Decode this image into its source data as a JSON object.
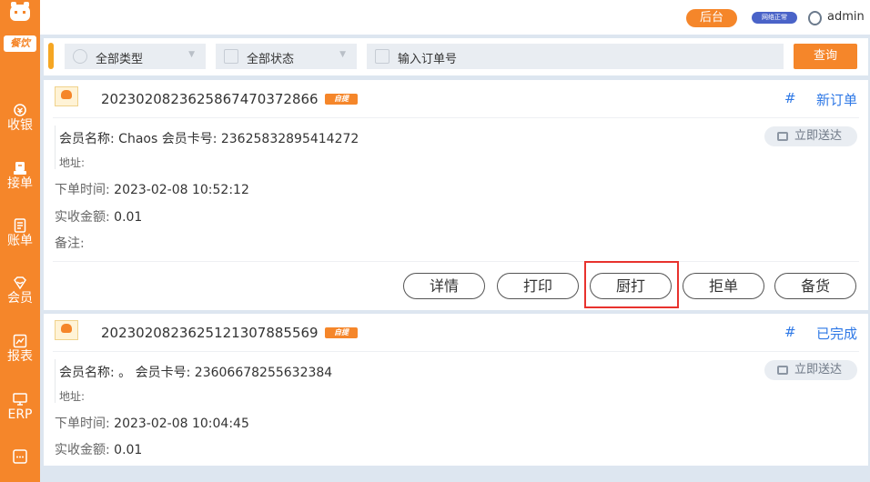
{
  "sidebar": {
    "logo_tag": "餐饮",
    "items": [
      {
        "label": "收银",
        "icon": "cashier-icon"
      },
      {
        "label": "接单",
        "icon": "receive-order-icon"
      },
      {
        "label": "账单",
        "icon": "bill-icon"
      },
      {
        "label": "会员",
        "icon": "member-icon"
      },
      {
        "label": "报表",
        "icon": "report-icon"
      },
      {
        "label": "ERP",
        "icon": "erp-icon"
      },
      {
        "label": "",
        "icon": "more-icon"
      }
    ]
  },
  "topbar": {
    "admin_button": "后台",
    "system_badge": "网络正常",
    "username": "admin"
  },
  "filters": {
    "type_select": "全部类型",
    "status_select": "全部状态",
    "order_input_placeholder": "输入订单号",
    "query_button": "查询"
  },
  "orders": [
    {
      "order_no": "20230208236258674703728​66",
      "pickup_tag": "自提",
      "hash": "#",
      "status": "新订单",
      "member_line": "会员名称: Chaos 会员卡号: 23625832895414272",
      "address_label": "地址:",
      "deliver_button": "立即送达",
      "order_time_label": "下单时间:",
      "order_time": "2023-02-08 10:52:12",
      "amount_label": "实收金额:",
      "amount": "0.01",
      "remark_label": "备注:",
      "actions": [
        "详情",
        "打印",
        "厨打",
        "拒单",
        "备货"
      ]
    },
    {
      "order_no": "20230208236251213078855​69",
      "pickup_tag": "自提",
      "hash": "#",
      "status": "已完成",
      "member_line": "会员名称: 。 会员卡号: 23606678255632384",
      "address_label": "地址:",
      "deliver_button": "立即送达",
      "order_time_label": "下单时间:",
      "order_time": "2023-02-08 10:04:45",
      "amount_label": "实收金额:",
      "amount": "0.01"
    }
  ]
}
